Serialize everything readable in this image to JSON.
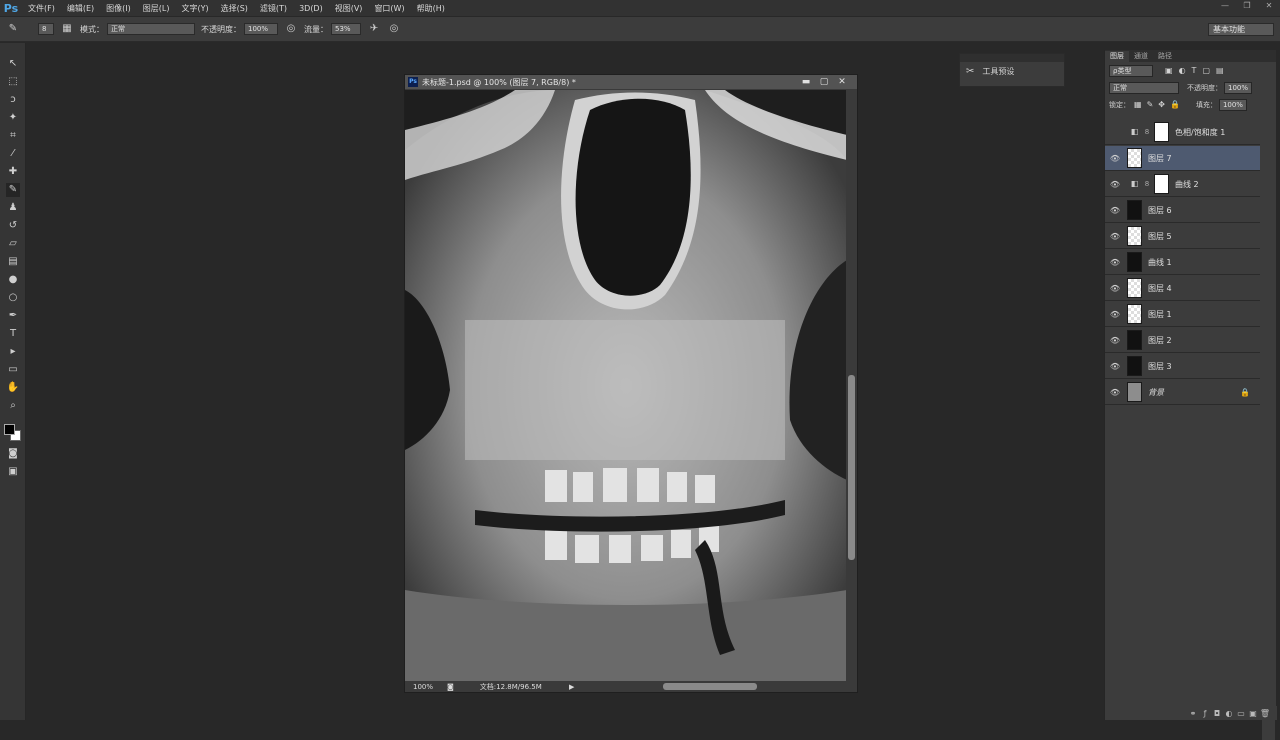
{
  "app": {
    "logo": "Ps"
  },
  "menu": [
    "文件(F)",
    "编辑(E)",
    "图像(I)",
    "图层(L)",
    "文字(Y)",
    "选择(S)",
    "滤镜(T)",
    "3D(D)",
    "视图(V)",
    "窗口(W)",
    "帮助(H)"
  ],
  "options": {
    "brush_size": "8",
    "mode_label": "模式：",
    "mode_value": "正常",
    "opacity_label": "不透明度：",
    "opacity_value": "100%",
    "flow_label": "流量：",
    "flow_value": "53%",
    "workspace": "基本功能"
  },
  "document": {
    "title": "未标题-1.psd @ 100% (图层 7, RGB/8) *",
    "zoom": "100%",
    "doc_info": "文档:12.8M/96.5M"
  },
  "props_panel": {
    "label": "工具预设"
  },
  "layers_panel": {
    "tabs": [
      "图层",
      "通道",
      "路径"
    ],
    "filter_kind": "ρ类型",
    "blend_mode": "正常",
    "opacity_label": "不透明度：",
    "opacity_value": "100%",
    "lock_label": "锁定：",
    "fill_label": "填充：",
    "fill_value": "100%",
    "layers": [
      {
        "name": "色相/饱和度 1",
        "visible": false,
        "thumb": "adj",
        "mask": true
      },
      {
        "name": "图层 7",
        "visible": true,
        "thumb": "checker",
        "selected": true
      },
      {
        "name": "曲线 2",
        "visible": true,
        "thumb": "adj",
        "mask": true
      },
      {
        "name": "图层 6",
        "visible": true,
        "thumb": "dark"
      },
      {
        "name": "图层 5",
        "visible": true,
        "thumb": "checker"
      },
      {
        "name": "曲线 1",
        "visible": true,
        "thumb": "dark"
      },
      {
        "name": "图层 4",
        "visible": true,
        "thumb": "checker"
      },
      {
        "name": "图层 1",
        "visible": true,
        "thumb": "checker"
      },
      {
        "name": "图层 2",
        "visible": true,
        "thumb": "dark"
      },
      {
        "name": "图层 3",
        "visible": true,
        "thumb": "dark"
      },
      {
        "name": "背景",
        "visible": true,
        "thumb": "gray",
        "locked": true
      }
    ]
  }
}
